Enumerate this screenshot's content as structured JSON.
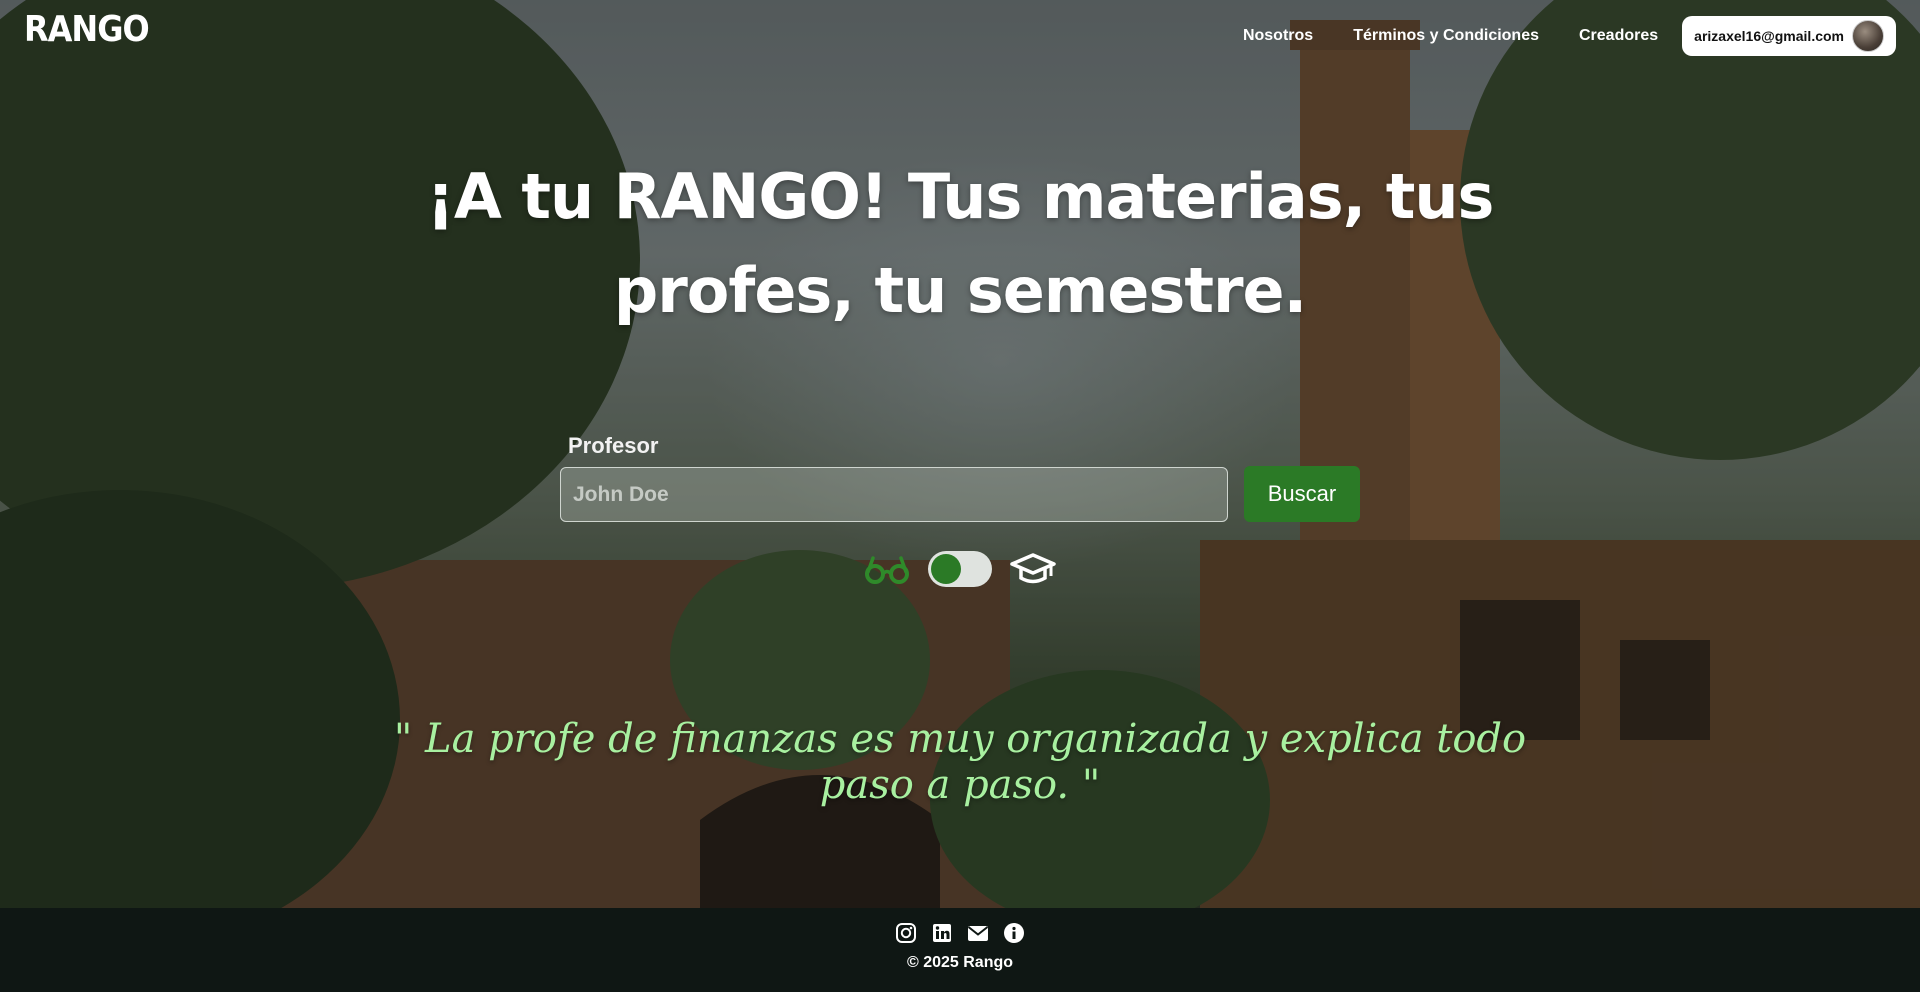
{
  "brand": {
    "logo_text": "RANGO"
  },
  "nav": {
    "links": [
      "Nosotros",
      "Términos y Condiciones",
      "Creadores"
    ],
    "user_email": "arizaxel16@gmail.com"
  },
  "hero": {
    "headline": "¡A tu RANGO! Tus materias, tus profes, tu semestre.",
    "quote": "\" La profe de finanzas es muy organizada y explica todo paso a paso. \""
  },
  "search": {
    "label": "Profesor",
    "placeholder": "John Doe",
    "value": "",
    "button_label": "Buscar"
  },
  "mode_toggle": {
    "left_icon": "glasses-icon",
    "right_icon": "graduation-cap-icon",
    "selected": "left"
  },
  "footer": {
    "icons": [
      "instagram-icon",
      "linkedin-icon",
      "email-icon",
      "info-icon"
    ],
    "copyright": "© 2025 Rango"
  },
  "colors": {
    "accent": "#2b7a26",
    "quote": "#a8f0a0",
    "footer_bg": "#0f1714"
  }
}
